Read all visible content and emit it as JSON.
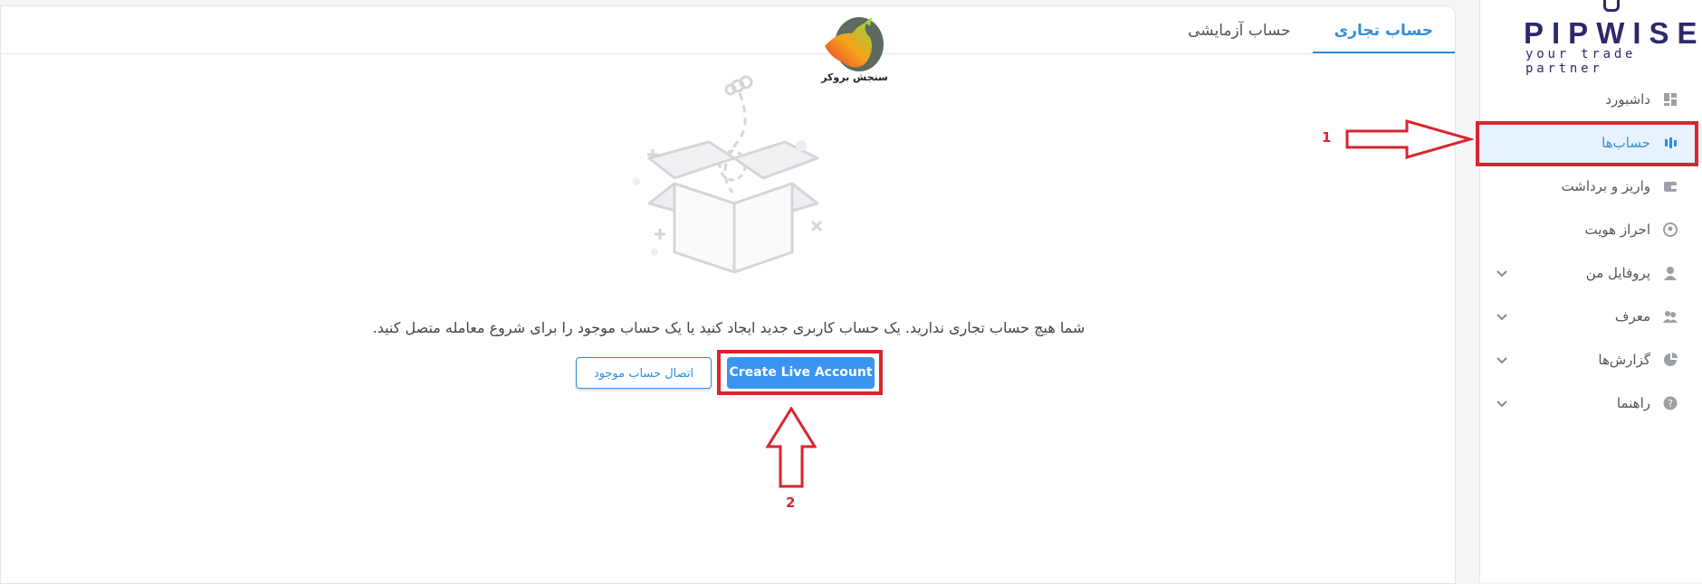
{
  "tabs": [
    {
      "label": "حساب تجاری",
      "active": true
    },
    {
      "label": "حساب آزمایشی",
      "active": false
    }
  ],
  "broker": {
    "name": "سنجش بروکر"
  },
  "empty_state": {
    "message": "شما هیچ حساب تجاری ندارید. یک حساب کاربری جدید ایجاد کنید یا یک حساب موجود را برای شروع معامله متصل کنید.",
    "connect_label": "اتصال حساب موجود",
    "create_label": "Create Live Account"
  },
  "annotations": {
    "step1": "1",
    "step2": "2",
    "highlight_color": "#d7262e"
  },
  "brand": {
    "logo_text": "PIPWISE",
    "tagline": "your trade partner",
    "color": "#2b2a6b",
    "accent": "#2e8ee0"
  },
  "sidebar": {
    "items": [
      {
        "label": "داشبورد",
        "icon": "dashboard-icon",
        "active": false,
        "expandable": false
      },
      {
        "label": "حساب‌ها",
        "icon": "accounts-icon",
        "active": true,
        "expandable": false
      },
      {
        "label": "واریز و برداشت",
        "icon": "wallet-icon",
        "active": false,
        "expandable": false
      },
      {
        "label": "احراز هویت",
        "icon": "identity-icon",
        "active": false,
        "expandable": false
      },
      {
        "label": "پروفایل من",
        "icon": "user-icon",
        "active": false,
        "expandable": true
      },
      {
        "label": "معرف",
        "icon": "referral-icon",
        "active": false,
        "expandable": true
      },
      {
        "label": "گزارش‌ها",
        "icon": "pie-chart-icon",
        "active": false,
        "expandable": true
      },
      {
        "label": "راهنما",
        "icon": "help-icon",
        "active": false,
        "expandable": true
      }
    ]
  }
}
